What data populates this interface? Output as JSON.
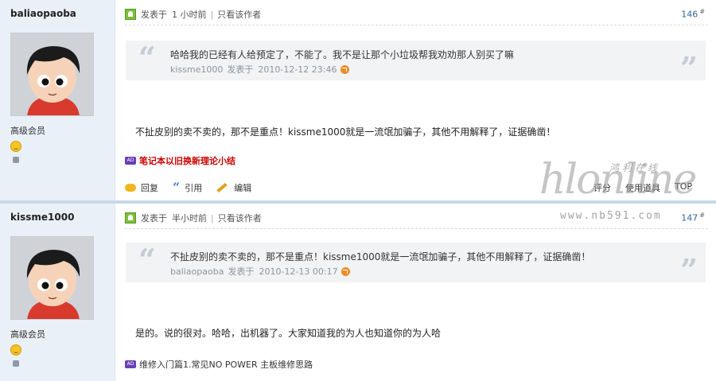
{
  "posts": [
    {
      "username": "baliaopaoba",
      "rank": "高级会员",
      "posted_prefix": "发表于",
      "posted_time": "1 小时前",
      "author_only": "只看该作者",
      "floor": "146",
      "floor_mark": "#",
      "quote_text": "哈哈我的已经有人给预定了，不能了。我不是让那个小垃圾帮我劝劝那人别买了嘛",
      "quote_author": "kissme1000",
      "quote_posted": "发表于",
      "quote_time": "2010-12-12 23:46",
      "message": "不扯皮别的卖不卖的，那不是重点！kissme1000就是一流氓加骗子，其他不用解释了，证据确凿！",
      "ad_text": "笔记本以旧换新理论小结",
      "ad_badge": "AD",
      "actions": {
        "reply": "回复",
        "quote": "引用",
        "edit": "编辑"
      },
      "right_actions": {
        "rate": "评分",
        "use_tool": "使用道具",
        "top": "TOP"
      }
    },
    {
      "username": "kissme1000",
      "rank": "高级会员",
      "posted_prefix": "发表于",
      "posted_time": "半小时前",
      "author_only": "只看该作者",
      "floor": "147",
      "floor_mark": "#",
      "quote_text": "不扯皮别的卖不卖的，那不是重点！kissme1000就是一流氓加骗子，其他不用解释了，证据确凿！",
      "quote_author": "baliaopaoba",
      "quote_posted": "发表于",
      "quote_time": "2010-12-13 00:17",
      "message": "是的。说的很对。哈哈，出机器了。大家知道我的为人也知道你的为人哈",
      "ad_text": "维修入门篇1.常见NO POWER 主板维修思路",
      "ad_badge": "AD"
    }
  ],
  "watermark": {
    "big": "hlonline",
    "cn": "鸿利在线",
    "url": "www.nb591.com"
  },
  "colors": {
    "sidebar": "#eaf0f7",
    "floor": "#336699",
    "ad_red": "#cc0000",
    "quote_bg": "#f1f3f5"
  }
}
